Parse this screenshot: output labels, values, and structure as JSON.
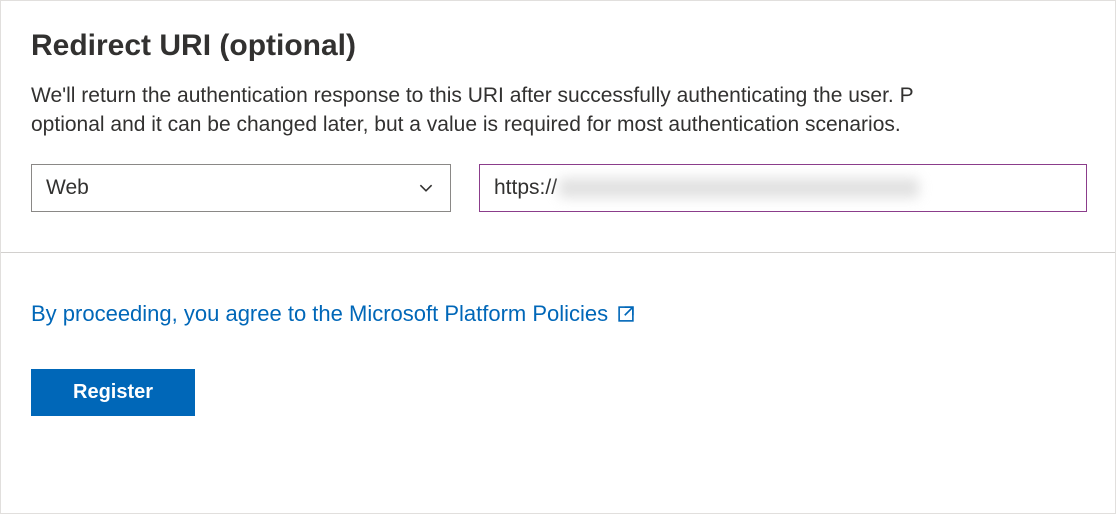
{
  "section": {
    "heading": "Redirect URI (optional)",
    "description_line1": "We'll return the authentication response to this URI after successfully authenticating the user. P",
    "description_line2": "optional and it can be changed later, but a value is required for most authentication scenarios."
  },
  "platform": {
    "selected": "Web"
  },
  "uri_input": {
    "prefix": "https://"
  },
  "agreement": {
    "text": "By proceeding, you agree to the Microsoft Platform Policies"
  },
  "buttons": {
    "register": "Register"
  },
  "colors": {
    "primary": "#0067b8",
    "input_focus_border": "#8b3d8b"
  }
}
